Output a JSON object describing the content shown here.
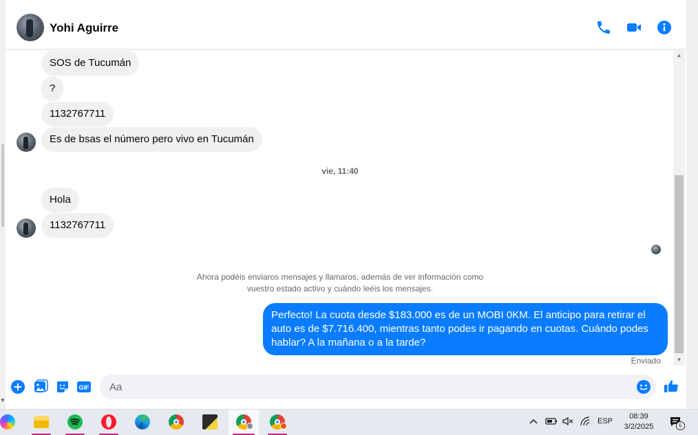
{
  "contact": {
    "name": "Yohi Aguirre"
  },
  "header_actions": [
    {
      "icon": "phone-icon"
    },
    {
      "icon": "video-camera-icon"
    },
    {
      "icon": "info-icon"
    }
  ],
  "messages_in": [
    {
      "text": "SOS de Tucumán"
    },
    {
      "text": "?"
    },
    {
      "text": "1132767711"
    },
    {
      "text": "Es de bsas el número pero vivo en Tucumán"
    },
    {
      "text": "Hola"
    },
    {
      "text": "1132767711"
    }
  ],
  "timestamp": "vie, 11:40",
  "notice": "Ahora podéis enviaros mensajes y llamaros, además de ver información como vuestro estado activo y cuándo leéis los mensajes.",
  "message_out": {
    "text": "Perfecto! La cuota desde $183.000 es de un MOBI 0KM. El anticipo para retirar el auto es de $7.716.400, mientras tanto podes ir pagando en cuotas. Cuándo podes hablar? A la mañana o a la tarde?",
    "status": "Enviado"
  },
  "composer": {
    "placeholder": "Aa",
    "gif_label": "GIF",
    "actions": [
      "plus-icon",
      "photo-icon",
      "sticker-icon",
      "gif-icon",
      "emoji-icon",
      "thumbs-up-icon"
    ]
  },
  "colors": {
    "accent": "#0a7cff",
    "bubble_in": "#f0f0f0",
    "taskbar": "#e6e9ef",
    "underline": "#c4237a"
  },
  "taskbar": {
    "apps": [
      "copilot-icon",
      "file-explorer-icon",
      "spotify-icon",
      "opera-icon",
      "edge-icon",
      "chrome-icon",
      "sticky-notes-icon",
      "chrome-profile-y-icon",
      "chrome-profile-r-icon"
    ],
    "language": "ESP",
    "time": "08:39",
    "date": "3/2/2025",
    "notifications": "6"
  }
}
